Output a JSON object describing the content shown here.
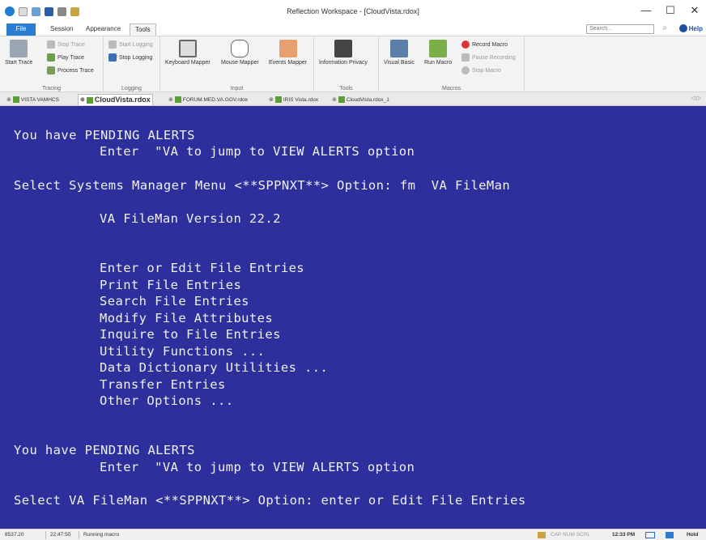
{
  "window": {
    "title": "Reflection Workspace - [CloudVista.rdox]",
    "minimize": "—",
    "maximize": "☐",
    "close": "✕"
  },
  "ribbon_tabs": {
    "file": "File",
    "session": "Session",
    "appearance": "Appearance",
    "tools": "Tools",
    "search_placeholder": "Search...",
    "help": "Help"
  },
  "ribbon": {
    "tracing": {
      "label": "Tracing",
      "start_trace": "Start Trace",
      "stop_trace": "Stop Trace",
      "play_trace": "Play Trace",
      "process_trace": "Process Trace"
    },
    "logging": {
      "label": "Logging",
      "start_logging": "Start Logging",
      "stop_logging": "Stop Logging"
    },
    "input": {
      "label": "Input",
      "keyboard_mapper": "Keyboard Mapper",
      "mouse_mapper": "Mouse Mapper",
      "events_mapper": "Events Mapper"
    },
    "tools": {
      "label": "Tools",
      "information_privacy": "Information Privacy"
    },
    "macros": {
      "label": "Macros",
      "visual_basic": "Visual Basic",
      "run_macro": "Run Macro",
      "record_macro": "Record Macro",
      "pause_recording": "Pause Recording",
      "stop_macro": "Stop Macro"
    }
  },
  "doc_tabs": [
    {
      "label": "VISTA VAMHCS"
    },
    {
      "label": "CloudVista.rdox"
    },
    {
      "label": "FORUM.MED.VA.GOV.rdox"
    },
    {
      "label": "IRIS Vista.rdox"
    },
    {
      "label": "CloudVista.rdox_1"
    }
  ],
  "terminal": {
    "lines": [
      "You have PENDING ALERTS",
      "Enter  \"VA to jump to VIEW ALERTS option",
      "Select Systems Manager Menu <**SPPNXT**> Option: fm  VA FileMan",
      "VA FileMan Version 22.2",
      "Enter or Edit File Entries",
      "Print File Entries",
      "Search File Entries",
      "Modify File Attributes",
      "Inquire to File Entries",
      "Utility Functions ...",
      "Data Dictionary Utilities ...",
      "Transfer Entries",
      "Other Options ...",
      "You have PENDING ALERTS",
      "Enter  \"VA to jump to VIEW ALERTS option",
      "Select VA FileMan <**SPPNXT**> Option: enter or Edit File Entries"
    ]
  },
  "status": {
    "position": "8537.20",
    "elapsed": "22:47:50",
    "message": "Running macro",
    "indicators": "CAP NUM SCRL",
    "time": "12:33 PM",
    "hold": "Hold"
  },
  "colors": {
    "terminal_bg": "#2d2f9c",
    "terminal_fg": "#f0f0f0",
    "file_tab": "#2b7cd3"
  }
}
